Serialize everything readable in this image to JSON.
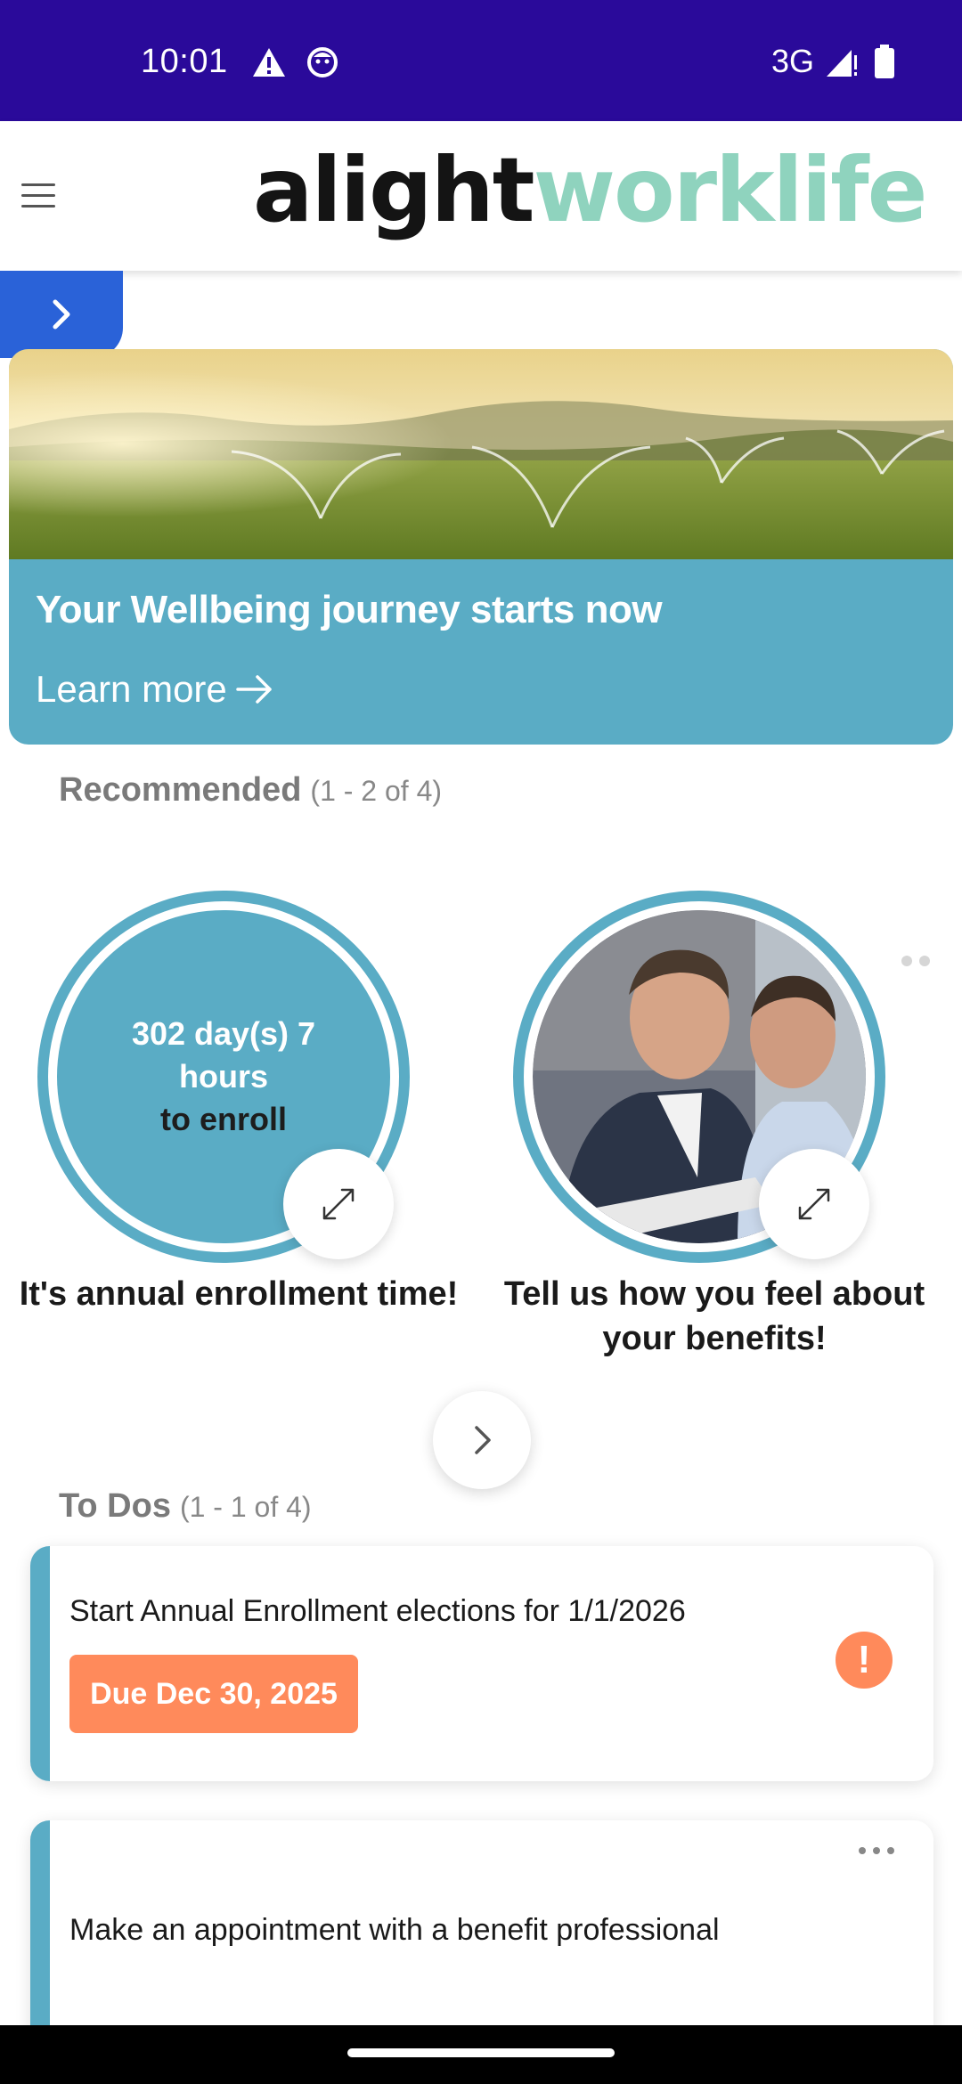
{
  "status_bar": {
    "time": "10:01",
    "network": "3G",
    "icons": [
      "warning-icon",
      "face-icon",
      "signal-icon",
      "battery-icon"
    ]
  },
  "header": {
    "logo_part1": "alight",
    "logo_part2": "worklife",
    "icons": [
      "menu-icon"
    ]
  },
  "side_toggle": {
    "icon": "chevron-right-icon"
  },
  "hero": {
    "title": "Your Wellbeing journey starts now",
    "link_label": "Learn more"
  },
  "recommended": {
    "heading": "Recommended",
    "count": "(1 - 2 of 4)",
    "cards": [
      {
        "countdown_line1": "302 day(s) 7",
        "countdown_line2": "hours",
        "countdown_line3": "to enroll",
        "title": "It's annual enrollment time!"
      },
      {
        "title": "Tell us how you feel about your benefits!"
      }
    ]
  },
  "todos": {
    "heading": "To Dos",
    "count": "(1 - 1 of 4)",
    "items": [
      {
        "title": "Start Annual Enrollment elections for 1/1/2026",
        "due": "Due Dec 30, 2025",
        "alert": "!"
      },
      {
        "title": "Make an appointment with a benefit professional"
      }
    ]
  },
  "colors": {
    "status_bar": "#2a0a9a",
    "brand_teal": "#5aacc5",
    "logo_green": "#8fd3be",
    "toggle_blue": "#2a62d8",
    "due_orange": "#ff8a5b"
  }
}
